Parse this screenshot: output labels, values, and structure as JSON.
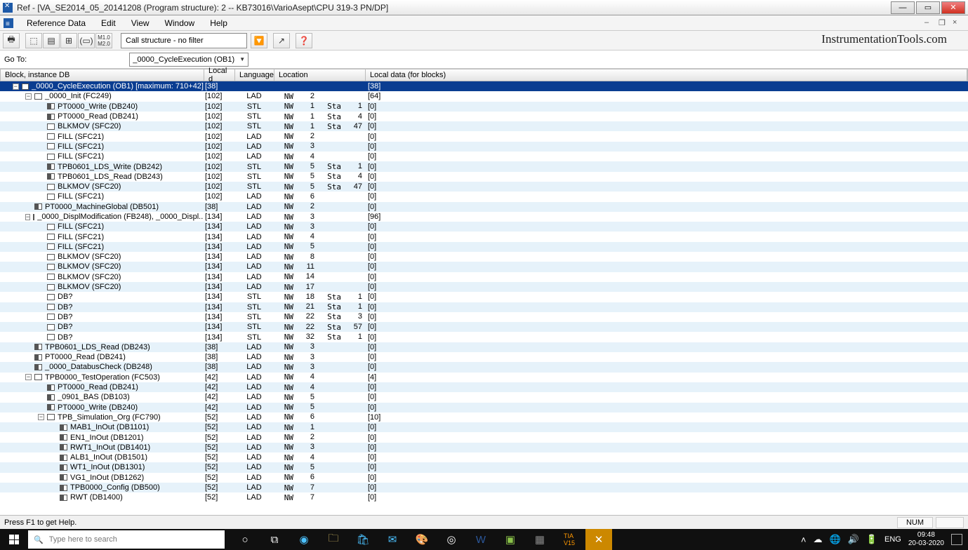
{
  "title": "Ref - [VA_SE2014_05_20141208 (Program structure): 2 -- KB73016\\VarioAsept\\CPU 319-3 PN/DP]",
  "menu": {
    "items": [
      "Reference Data",
      "Edit",
      "View",
      "Window",
      "Help"
    ]
  },
  "toolbar": {
    "filter": "Call structure - no filter"
  },
  "watermark": "InstrumentationTools.com",
  "goto": {
    "label": "Go To:",
    "value": "_0000_CycleExecution (OB1)"
  },
  "columns": {
    "block": "Block, instance DB",
    "local": "Local d",
    "lang": "Language",
    "loc": "Location",
    "ldata": "Local data (for blocks)"
  },
  "rows": [
    {
      "depth": 0,
      "toggle": "-",
      "icon": "open",
      "name": "_0000_CycleExecution (OB1) [maximum: 710+42]",
      "local": "[38]",
      "lang": "",
      "loc": [
        "",
        "",
        "",
        ""
      ],
      "ldata": "[38]",
      "sel": true
    },
    {
      "depth": 1,
      "toggle": "-",
      "icon": "open",
      "name": "_0000_Init (FC249)",
      "local": "[102]",
      "lang": "LAD",
      "loc": [
        "NW",
        "2",
        "",
        ""
      ],
      "ldata": "[64]"
    },
    {
      "depth": 2,
      "toggle": "",
      "icon": "part",
      "name": "PT0000_Write (DB240)",
      "local": "[102]",
      "lang": "STL",
      "loc": [
        "NW",
        "1",
        "Sta",
        "1"
      ],
      "ldata": "[0]"
    },
    {
      "depth": 2,
      "toggle": "",
      "icon": "part",
      "name": "PT0000_Read (DB241)",
      "local": "[102]",
      "lang": "STL",
      "loc": [
        "NW",
        "1",
        "Sta",
        "4"
      ],
      "ldata": "[0]"
    },
    {
      "depth": 2,
      "toggle": "",
      "icon": "open",
      "name": "BLKMOV (SFC20)",
      "local": "[102]",
      "lang": "STL",
      "loc": [
        "NW",
        "1",
        "Sta",
        "47"
      ],
      "ldata": "[0]"
    },
    {
      "depth": 2,
      "toggle": "",
      "icon": "open",
      "name": "FILL (SFC21)",
      "local": "[102]",
      "lang": "LAD",
      "loc": [
        "NW",
        "2",
        "",
        ""
      ],
      "ldata": "[0]"
    },
    {
      "depth": 2,
      "toggle": "",
      "icon": "open",
      "name": "FILL (SFC21)",
      "local": "[102]",
      "lang": "LAD",
      "loc": [
        "NW",
        "3",
        "",
        ""
      ],
      "ldata": "[0]"
    },
    {
      "depth": 2,
      "toggle": "",
      "icon": "open",
      "name": "FILL (SFC21)",
      "local": "[102]",
      "lang": "LAD",
      "loc": [
        "NW",
        "4",
        "",
        ""
      ],
      "ldata": "[0]"
    },
    {
      "depth": 2,
      "toggle": "",
      "icon": "part",
      "name": "TPB0601_LDS_Write (DB242)",
      "local": "[102]",
      "lang": "STL",
      "loc": [
        "NW",
        "5",
        "Sta",
        "1"
      ],
      "ldata": "[0]"
    },
    {
      "depth": 2,
      "toggle": "",
      "icon": "part",
      "name": "TPB0601_LDS_Read (DB243)",
      "local": "[102]",
      "lang": "STL",
      "loc": [
        "NW",
        "5",
        "Sta",
        "4"
      ],
      "ldata": "[0]"
    },
    {
      "depth": 2,
      "toggle": "",
      "icon": "open",
      "name": "BLKMOV (SFC20)",
      "local": "[102]",
      "lang": "STL",
      "loc": [
        "NW",
        "5",
        "Sta",
        "47"
      ],
      "ldata": "[0]"
    },
    {
      "depth": 2,
      "toggle": "",
      "icon": "open",
      "name": "FILL (SFC21)",
      "local": "[102]",
      "lang": "LAD",
      "loc": [
        "NW",
        "6",
        "",
        ""
      ],
      "ldata": "[0]"
    },
    {
      "depth": 1,
      "toggle": "",
      "icon": "part",
      "name": "PT0000_MachineGlobal (DB501)",
      "local": "[38]",
      "lang": "LAD",
      "loc": [
        "NW",
        "2",
        "",
        ""
      ],
      "ldata": "[0]"
    },
    {
      "depth": 1,
      "toggle": "-",
      "icon": "open",
      "name": "_0000_DisplModification (FB248), _0000_Displ...",
      "local": "[134]",
      "lang": "LAD",
      "loc": [
        "NW",
        "3",
        "",
        ""
      ],
      "ldata": "[96]"
    },
    {
      "depth": 2,
      "toggle": "",
      "icon": "open",
      "name": "FILL (SFC21)",
      "local": "[134]",
      "lang": "LAD",
      "loc": [
        "NW",
        "3",
        "",
        ""
      ],
      "ldata": "[0]"
    },
    {
      "depth": 2,
      "toggle": "",
      "icon": "open",
      "name": "FILL (SFC21)",
      "local": "[134]",
      "lang": "LAD",
      "loc": [
        "NW",
        "4",
        "",
        ""
      ],
      "ldata": "[0]"
    },
    {
      "depth": 2,
      "toggle": "",
      "icon": "open",
      "name": "FILL (SFC21)",
      "local": "[134]",
      "lang": "LAD",
      "loc": [
        "NW",
        "5",
        "",
        ""
      ],
      "ldata": "[0]"
    },
    {
      "depth": 2,
      "toggle": "",
      "icon": "open",
      "name": "BLKMOV (SFC20)",
      "local": "[134]",
      "lang": "LAD",
      "loc": [
        "NW",
        "8",
        "",
        ""
      ],
      "ldata": "[0]"
    },
    {
      "depth": 2,
      "toggle": "",
      "icon": "open",
      "name": "BLKMOV (SFC20)",
      "local": "[134]",
      "lang": "LAD",
      "loc": [
        "NW",
        "11",
        "",
        ""
      ],
      "ldata": "[0]"
    },
    {
      "depth": 2,
      "toggle": "",
      "icon": "open",
      "name": "BLKMOV (SFC20)",
      "local": "[134]",
      "lang": "LAD",
      "loc": [
        "NW",
        "14",
        "",
        ""
      ],
      "ldata": "[0]"
    },
    {
      "depth": 2,
      "toggle": "",
      "icon": "open",
      "name": "BLKMOV (SFC20)",
      "local": "[134]",
      "lang": "LAD",
      "loc": [
        "NW",
        "17",
        "",
        ""
      ],
      "ldata": "[0]"
    },
    {
      "depth": 2,
      "toggle": "",
      "icon": "open",
      "name": "DB?",
      "local": "[134]",
      "lang": "STL",
      "loc": [
        "NW",
        "18",
        "Sta",
        "1"
      ],
      "ldata": "[0]"
    },
    {
      "depth": 2,
      "toggle": "",
      "icon": "open",
      "name": "DB?",
      "local": "[134]",
      "lang": "STL",
      "loc": [
        "NW",
        "21",
        "Sta",
        "1"
      ],
      "ldata": "[0]"
    },
    {
      "depth": 2,
      "toggle": "",
      "icon": "open",
      "name": "DB?",
      "local": "[134]",
      "lang": "STL",
      "loc": [
        "NW",
        "22",
        "Sta",
        "3"
      ],
      "ldata": "[0]"
    },
    {
      "depth": 2,
      "toggle": "",
      "icon": "open",
      "name": "DB?",
      "local": "[134]",
      "lang": "STL",
      "loc": [
        "NW",
        "22",
        "Sta",
        "57"
      ],
      "ldata": "[0]"
    },
    {
      "depth": 2,
      "toggle": "",
      "icon": "open",
      "name": "DB?",
      "local": "[134]",
      "lang": "STL",
      "loc": [
        "NW",
        "32",
        "Sta",
        "1"
      ],
      "ldata": "[0]"
    },
    {
      "depth": 1,
      "toggle": "",
      "icon": "part",
      "name": "TPB0601_LDS_Read (DB243)",
      "local": "[38]",
      "lang": "LAD",
      "loc": [
        "NW",
        "3",
        "",
        ""
      ],
      "ldata": "[0]"
    },
    {
      "depth": 1,
      "toggle": "",
      "icon": "part",
      "name": "PT0000_Read (DB241)",
      "local": "[38]",
      "lang": "LAD",
      "loc": [
        "NW",
        "3",
        "",
        ""
      ],
      "ldata": "[0]"
    },
    {
      "depth": 1,
      "toggle": "",
      "icon": "part",
      "name": "_0000_DatabusCheck (DB248)",
      "local": "[38]",
      "lang": "LAD",
      "loc": [
        "NW",
        "3",
        "",
        ""
      ],
      "ldata": "[0]"
    },
    {
      "depth": 1,
      "toggle": "-",
      "icon": "open",
      "name": "TPB0000_TestOperation (FC503)",
      "local": "[42]",
      "lang": "LAD",
      "loc": [
        "NW",
        "4",
        "",
        ""
      ],
      "ldata": "[4]"
    },
    {
      "depth": 2,
      "toggle": "",
      "icon": "part",
      "name": "PT0000_Read (DB241)",
      "local": "[42]",
      "lang": "LAD",
      "loc": [
        "NW",
        "4",
        "",
        ""
      ],
      "ldata": "[0]"
    },
    {
      "depth": 2,
      "toggle": "",
      "icon": "part",
      "name": "_0901_BAS (DB103)",
      "local": "[42]",
      "lang": "LAD",
      "loc": [
        "NW",
        "5",
        "",
        ""
      ],
      "ldata": "[0]"
    },
    {
      "depth": 2,
      "toggle": "",
      "icon": "part",
      "name": "PT0000_Write (DB240)",
      "local": "[42]",
      "lang": "LAD",
      "loc": [
        "NW",
        "5",
        "",
        ""
      ],
      "ldata": "[0]"
    },
    {
      "depth": 2,
      "toggle": "-",
      "icon": "open",
      "name": "TPB_Simulation_Org (FC790)",
      "local": "[52]",
      "lang": "LAD",
      "loc": [
        "NW",
        "6",
        "",
        ""
      ],
      "ldata": "[10]"
    },
    {
      "depth": 3,
      "toggle": "",
      "icon": "part",
      "name": "MAB1_InOut (DB1101)",
      "local": "[52]",
      "lang": "LAD",
      "loc": [
        "NW",
        "1",
        "",
        ""
      ],
      "ldata": "[0]"
    },
    {
      "depth": 3,
      "toggle": "",
      "icon": "part",
      "name": "EN1_InOut (DB1201)",
      "local": "[52]",
      "lang": "LAD",
      "loc": [
        "NW",
        "2",
        "",
        ""
      ],
      "ldata": "[0]"
    },
    {
      "depth": 3,
      "toggle": "",
      "icon": "part",
      "name": "RWT1_InOut (DB1401)",
      "local": "[52]",
      "lang": "LAD",
      "loc": [
        "NW",
        "3",
        "",
        ""
      ],
      "ldata": "[0]"
    },
    {
      "depth": 3,
      "toggle": "",
      "icon": "part",
      "name": "ALB1_InOut (DB1501)",
      "local": "[52]",
      "lang": "LAD",
      "loc": [
        "NW",
        "4",
        "",
        ""
      ],
      "ldata": "[0]"
    },
    {
      "depth": 3,
      "toggle": "",
      "icon": "part",
      "name": "WT1_InOut (DB1301)",
      "local": "[52]",
      "lang": "LAD",
      "loc": [
        "NW",
        "5",
        "",
        ""
      ],
      "ldata": "[0]"
    },
    {
      "depth": 3,
      "toggle": "",
      "icon": "part",
      "name": "VG1_InOut (DB1262)",
      "local": "[52]",
      "lang": "LAD",
      "loc": [
        "NW",
        "6",
        "",
        ""
      ],
      "ldata": "[0]"
    },
    {
      "depth": 3,
      "toggle": "",
      "icon": "part",
      "name": "TPB0000_Config (DB500)",
      "local": "[52]",
      "lang": "LAD",
      "loc": [
        "NW",
        "7",
        "",
        ""
      ],
      "ldata": "[0]"
    },
    {
      "depth": 3,
      "toggle": "",
      "icon": "part",
      "name": "RWT (DB1400)",
      "local": "[52]",
      "lang": "LAD",
      "loc": [
        "NW",
        "7",
        "",
        ""
      ],
      "ldata": "[0]"
    }
  ],
  "status": {
    "help": "Press F1 to get Help.",
    "num": "NUM"
  },
  "taskbar": {
    "search_placeholder": "Type here to search",
    "lang": "ENG",
    "time": "09:48",
    "date": "20-03-2020"
  }
}
